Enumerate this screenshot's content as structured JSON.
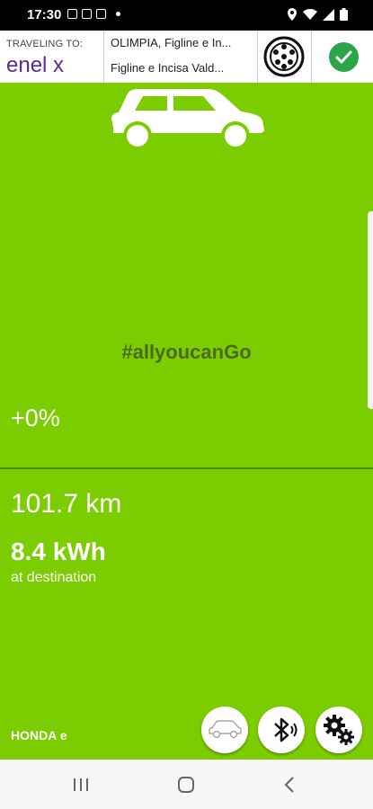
{
  "status_bar": {
    "time": "17:30"
  },
  "header": {
    "traveling_label": "TRAVELING TO:",
    "brand": "enel x",
    "destination_line1": "OLIMPIA, Figline e In...",
    "destination_line2": "Figline e Incisa Vald..."
  },
  "main": {
    "tagline": "#allyoucanGo",
    "charge_percent": "+0%",
    "distance": "101.7 km",
    "energy_value": "8.4 kWh",
    "energy_caption": "at destination",
    "vehicle_model": "HONDA e"
  },
  "colors": {
    "background": "#7ccd00",
    "tagline": "#4a6b1f",
    "confirm": "#2aa548"
  },
  "icons": [
    "car-icon",
    "charging-connector-icon",
    "check-icon",
    "bluetooth-icon",
    "gears-icon",
    "recents-icon",
    "home-icon",
    "back-icon"
  ]
}
